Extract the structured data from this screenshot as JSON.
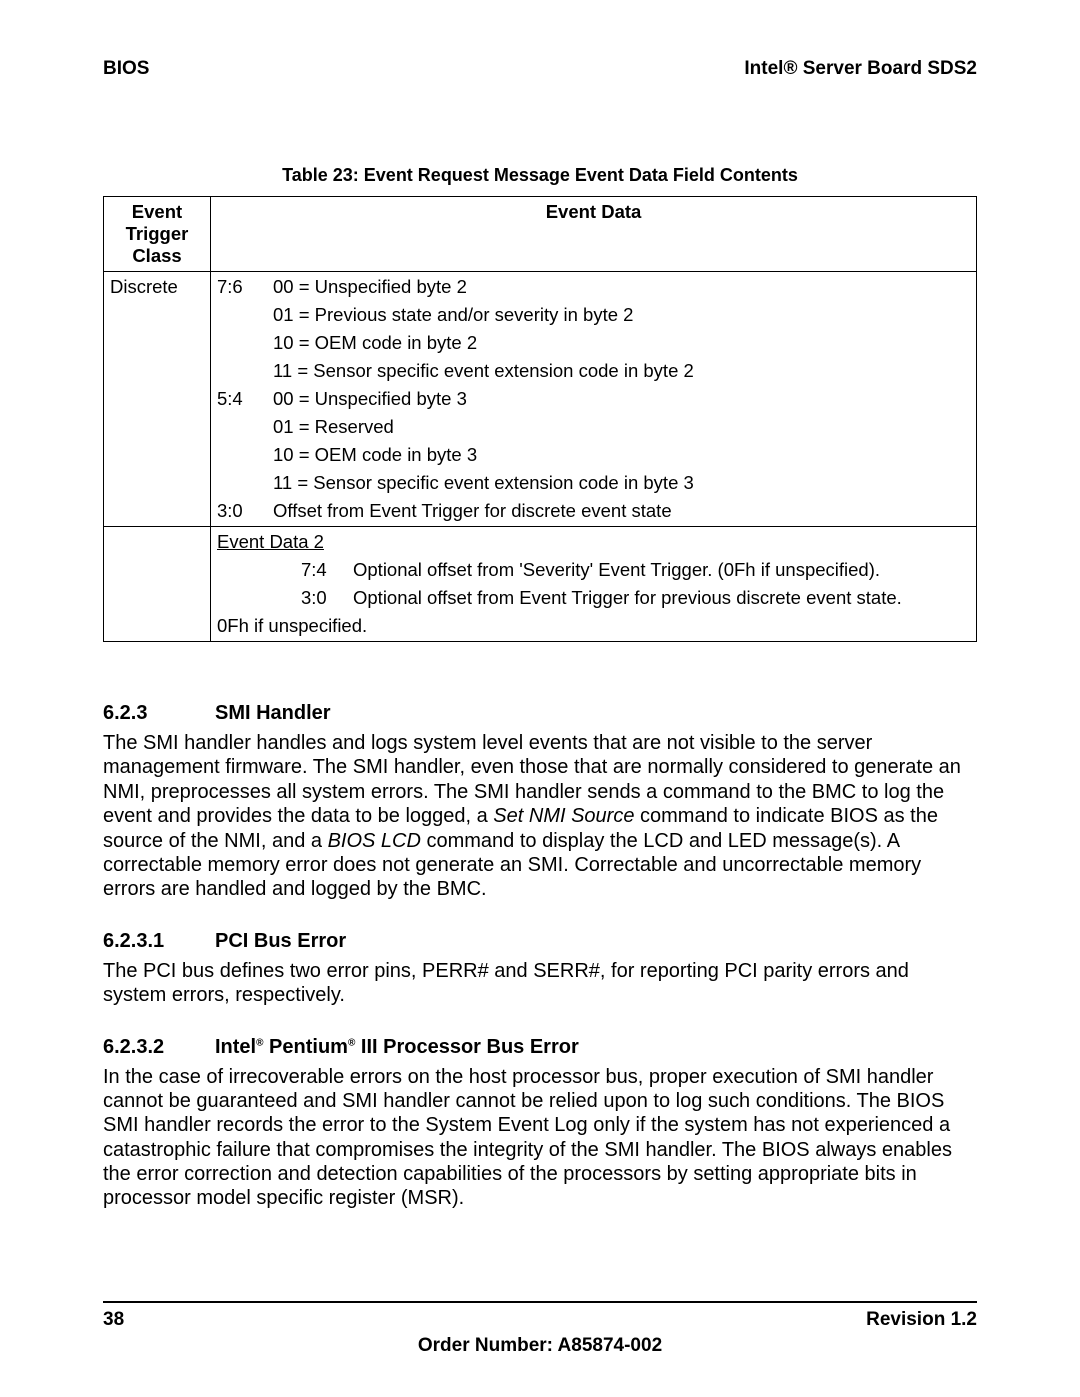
{
  "header": {
    "left": "BIOS",
    "right": "Intel® Server Board SDS2"
  },
  "table": {
    "caption": "Table 23: Event Request Message Event Data Field Contents",
    "col1": "Event Trigger Class",
    "col2": "Event Data",
    "row1col1": "Discrete",
    "r": {
      "a_bits": "7:6",
      "a0": "00 = Unspecified byte 2",
      "a1": "01 = Previous state and/or severity in byte 2",
      "a2": "10 = OEM code in byte 2",
      "a3": "11 = Sensor specific event extension code in byte 2",
      "b_bits": "5:4",
      "b0": "00 = Unspecified byte 3",
      "b1": "01 = Reserved",
      "b2": "10 = OEM code in byte 3",
      "b3": "11 = Sensor specific event extension code in byte 3",
      "c_bits": "3:0",
      "c0": "Offset from Event Trigger for discrete event state"
    },
    "row2": {
      "title": "Event Data 2",
      "l1b": "7:4",
      "l1t": "Optional offset from 'Severity' Event Trigger. (0Fh if unspecified).",
      "l2b": "3:0",
      "l2t": "Optional offset from Event Trigger for previous discrete event state.",
      "l3": "0Fh if unspecified."
    }
  },
  "s1": {
    "num": "6.2.3",
    "title": "SMI Handler",
    "p_a": "The SMI handler handles and logs system level events that are not visible to the server management firmware. The SMI handler, even those that are normally considered to generate an NMI, preprocesses all system errors. The SMI handler sends a command to the BMC to log the event and provides the data to be logged, a ",
    "p_i1": "Set NMI Source",
    "p_b": " command to indicate BIOS as the source of the NMI, and a ",
    "p_i2": "BIOS LCD",
    "p_c": " command to display the LCD and LED message(s). A correctable memory error does not generate an SMI. Correctable and uncorrectable memory errors are handled and logged by the BMC."
  },
  "s2": {
    "num": "6.2.3.1",
    "title": "PCI Bus Error",
    "p": "The PCI bus defines two error pins, PERR# and SERR#, for reporting PCI parity errors and system errors, respectively."
  },
  "s3": {
    "num": "6.2.3.2",
    "title_a": "Intel",
    "title_b": " Pentium",
    "title_c": " III Processor Bus Error",
    "reg": "®",
    "p": "In the case of irrecoverable errors on the host processor bus, proper execution of SMI handler cannot be guaranteed and SMI handler cannot be relied upon to log such conditions. The BIOS SMI handler records the error to the System Event Log only if the system has not experienced a catastrophic failure that compromises the integrity of the SMI handler. The BIOS always enables the error correction and detection capabilities of the processors by setting appropriate bits in processor model specific register (MSR)."
  },
  "footer": {
    "page": "38",
    "rev": "Revision 1.2",
    "order": "Order Number:  A85874-002"
  }
}
